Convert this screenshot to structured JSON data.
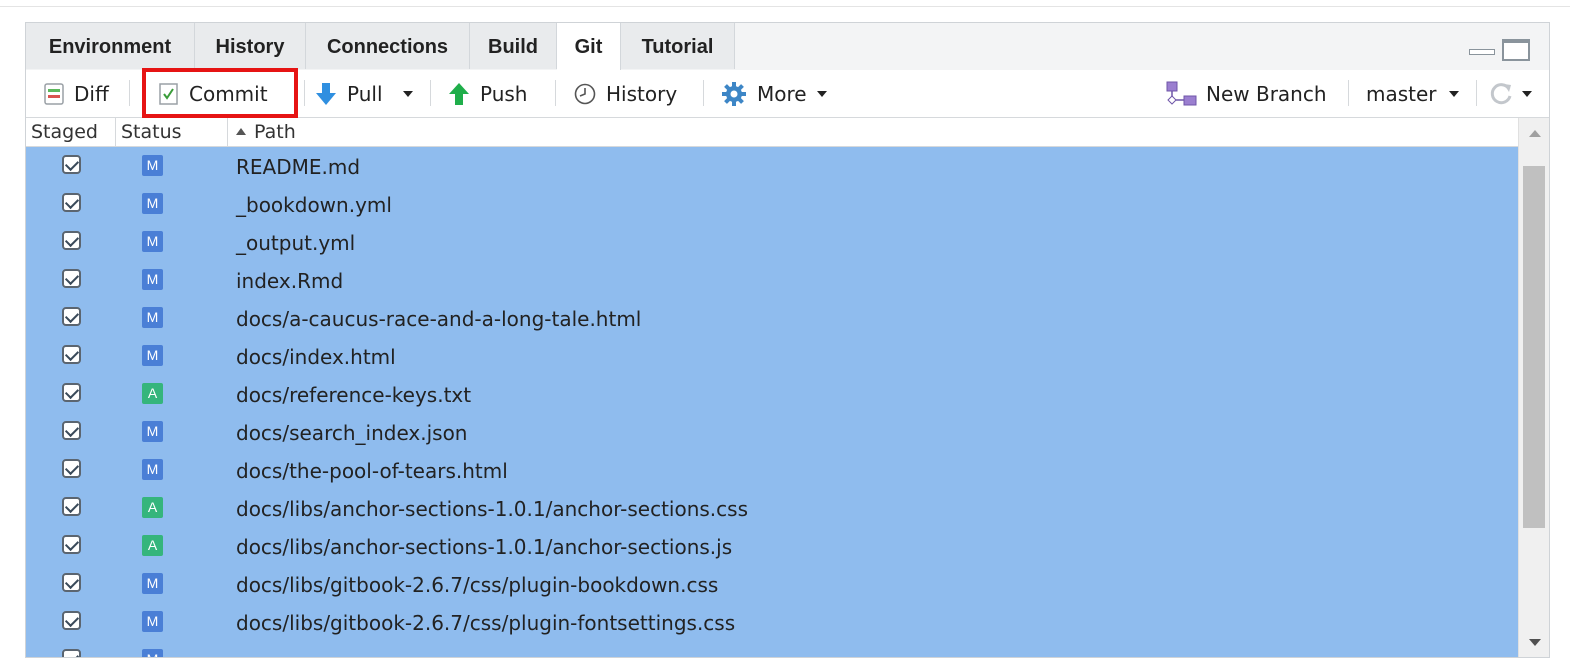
{
  "tabs": [
    {
      "label": "Environment",
      "active": false
    },
    {
      "label": "History",
      "active": false
    },
    {
      "label": "Connections",
      "active": false
    },
    {
      "label": "Build",
      "active": false
    },
    {
      "label": "Git",
      "active": true
    },
    {
      "label": "Tutorial",
      "active": false
    }
  ],
  "toolbar": {
    "diff": "Diff",
    "commit": "Commit",
    "pull": "Pull",
    "push": "Push",
    "history": "History",
    "more": "More",
    "new_branch": "New Branch",
    "branch": "master"
  },
  "columns": {
    "staged": "Staged",
    "status": "Status",
    "path": "Path"
  },
  "status_colors": {
    "M": "#4a7fd6",
    "A": "#35b57c"
  },
  "files": [
    {
      "staged": true,
      "status": "M",
      "path": "README.md"
    },
    {
      "staged": true,
      "status": "M",
      "path": "_bookdown.yml"
    },
    {
      "staged": true,
      "status": "M",
      "path": "_output.yml"
    },
    {
      "staged": true,
      "status": "M",
      "path": "index.Rmd"
    },
    {
      "staged": true,
      "status": "M",
      "path": "docs/a-caucus-race-and-a-long-tale.html"
    },
    {
      "staged": true,
      "status": "M",
      "path": "docs/index.html"
    },
    {
      "staged": true,
      "status": "A",
      "path": "docs/reference-keys.txt"
    },
    {
      "staged": true,
      "status": "M",
      "path": "docs/search_index.json"
    },
    {
      "staged": true,
      "status": "M",
      "path": "docs/the-pool-of-tears.html"
    },
    {
      "staged": true,
      "status": "A",
      "path": "docs/libs/anchor-sections-1.0.1/anchor-sections.css"
    },
    {
      "staged": true,
      "status": "A",
      "path": "docs/libs/anchor-sections-1.0.1/anchor-sections.js"
    },
    {
      "staged": true,
      "status": "M",
      "path": "docs/libs/gitbook-2.6.7/css/plugin-bookdown.css"
    },
    {
      "staged": true,
      "status": "M",
      "path": "docs/libs/gitbook-2.6.7/css/plugin-fontsettings.css"
    },
    {
      "staged": true,
      "status": "M",
      "path": ""
    }
  ],
  "icons": {
    "diff": "diff-icon",
    "commit": "commit-check-icon",
    "pull": "pull-arrow-down-icon",
    "push": "push-arrow-up-icon",
    "history": "clock-icon",
    "more": "gear-icon",
    "new_branch": "branch-icon",
    "refresh": "refresh-icon"
  }
}
